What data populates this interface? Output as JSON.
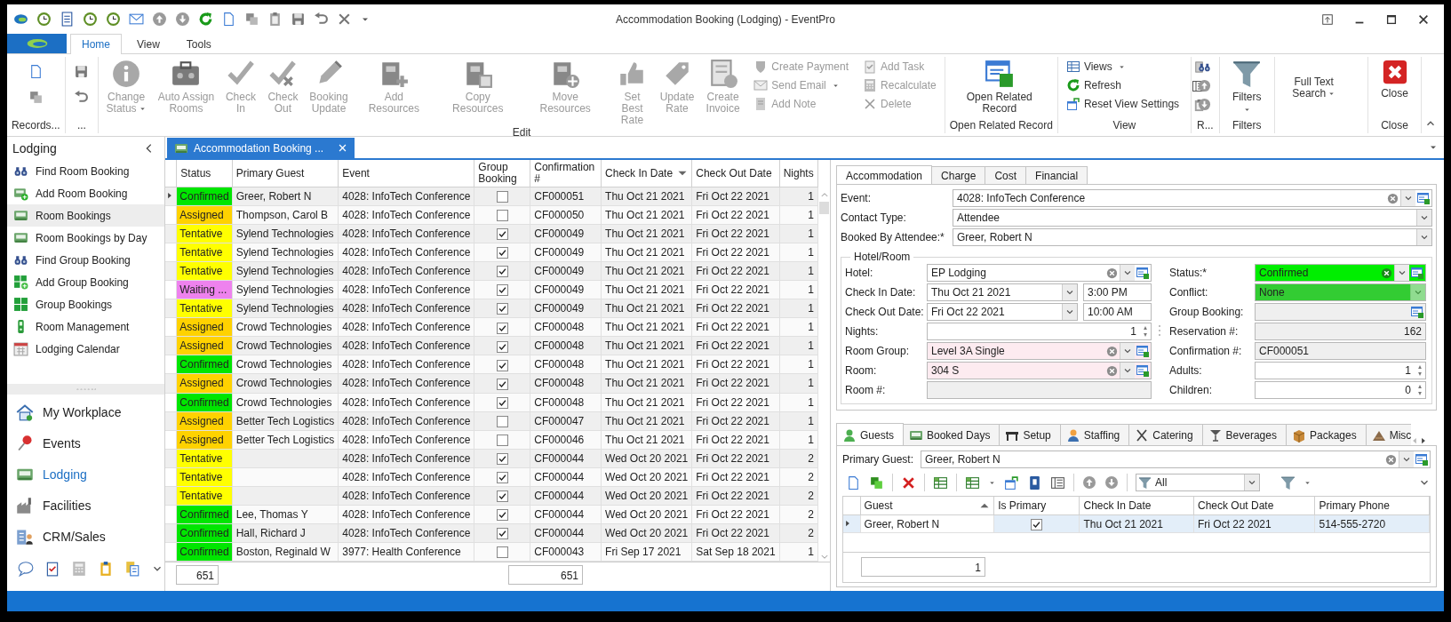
{
  "window": {
    "title": "Accommodation Booking (Lodging) - EventPro"
  },
  "ribbon": {
    "tabs": [
      {
        "label": "Home",
        "selected": true
      },
      {
        "label": "View",
        "selected": false
      },
      {
        "label": "Tools",
        "selected": false
      }
    ],
    "records_group": {
      "label": "Records..."
    },
    "save_group": {
      "label": "..."
    },
    "edit_group": {
      "label": "Edit",
      "large": [
        {
          "label": "Change Status",
          "dropdown": true,
          "disabled": true
        },
        {
          "label": "Auto Assign Rooms",
          "dropdown": false,
          "disabled": true
        },
        {
          "label": "Check In",
          "dropdown": false,
          "disabled": true
        },
        {
          "label": "Check Out",
          "dropdown": false,
          "disabled": true
        },
        {
          "label": "Booking Update",
          "dropdown": false,
          "disabled": true
        },
        {
          "label": "Add Resources",
          "dropdown": false,
          "disabled": true
        },
        {
          "label": "Copy Resources",
          "dropdown": false,
          "disabled": true
        },
        {
          "label": "Move Resources",
          "dropdown": false,
          "disabled": true
        },
        {
          "label": "Set Best Rate",
          "dropdown": false,
          "disabled": true
        },
        {
          "label": "Update Rate",
          "dropdown": false,
          "disabled": true
        },
        {
          "label": "Create Invoice",
          "dropdown": false,
          "disabled": true
        }
      ],
      "small": [
        {
          "label": "Create Payment",
          "dropdown": false,
          "disabled": true
        },
        {
          "label": "Send Email",
          "dropdown": true,
          "disabled": true
        },
        {
          "label": "Add Note",
          "dropdown": false,
          "disabled": true
        },
        {
          "label": "Add Task",
          "dropdown": false,
          "disabled": true
        },
        {
          "label": "Recalculate",
          "dropdown": false,
          "disabled": true
        },
        {
          "label": "Delete",
          "dropdown": false,
          "disabled": true
        }
      ]
    },
    "open_group": {
      "label": "Open Related Record",
      "button": "Open Related Record"
    },
    "view_group": {
      "label": "View",
      "buttons": [
        {
          "label": "Views",
          "dropdown": true
        },
        {
          "label": "Refresh",
          "dropdown": false
        },
        {
          "label": "Reset View Settings",
          "dropdown": false
        }
      ]
    },
    "r_group": {
      "label": "R..."
    },
    "filters_group": {
      "label": "Filters",
      "button": "Filters"
    },
    "search_button": "Full Text Search",
    "close_group": {
      "label": "Close",
      "button": "Close"
    }
  },
  "sidebar": {
    "title": "Lodging",
    "items": [
      {
        "label": "Find Room Booking",
        "selected": false
      },
      {
        "label": "Add Room Booking",
        "selected": false
      },
      {
        "label": "Room Bookings",
        "selected": true
      },
      {
        "label": "Room Bookings by Day",
        "selected": false
      },
      {
        "label": "Find Group Booking",
        "selected": false
      },
      {
        "label": "Add Group Booking",
        "selected": false
      },
      {
        "label": "Group Bookings",
        "selected": false
      },
      {
        "label": "Room Management",
        "selected": false
      },
      {
        "label": "Lodging Calendar",
        "selected": false
      }
    ],
    "nav": [
      {
        "label": "My Workplace",
        "selected": false
      },
      {
        "label": "Events",
        "selected": false
      },
      {
        "label": "Lodging",
        "selected": true
      },
      {
        "label": "Facilities",
        "selected": false
      },
      {
        "label": "CRM/Sales",
        "selected": false
      }
    ]
  },
  "document_tab": {
    "label": "Accommodation Booking ...",
    "selected": true
  },
  "grid": {
    "columns": [
      "Status",
      "Primary Guest",
      "Event",
      "Group Booking",
      "Confirmation #",
      "Check In Date",
      "Check Out Date",
      "Nights"
    ],
    "rows": [
      {
        "status": "Confirmed",
        "color": "#00e600",
        "guest": "Greer, Robert N",
        "event": "4028: InfoTech Conference",
        "group_booking": false,
        "confirmation": "CF000051",
        "check_in": "Thu Oct 21 2021",
        "check_out": "Fri Oct 22 2021",
        "nights": "1",
        "current": true
      },
      {
        "status": "Assigned",
        "color": "#ffd200",
        "guest": "Thompson, Carol B",
        "event": "4028: InfoTech Conference",
        "group_booking": false,
        "confirmation": "CF000050",
        "check_in": "Thu Oct 21 2021",
        "check_out": "Fri Oct 22 2021",
        "nights": "1",
        "current": false
      },
      {
        "status": "Tentative",
        "color": "#ffff00",
        "guest": "Sylend Technologies",
        "event": "4028: InfoTech Conference",
        "group_booking": true,
        "confirmation": "CF000049",
        "check_in": "Thu Oct 21 2021",
        "check_out": "Fri Oct 22 2021",
        "nights": "1",
        "current": false
      },
      {
        "status": "Tentative",
        "color": "#ffff00",
        "guest": "Sylend Technologies",
        "event": "4028: InfoTech Conference",
        "group_booking": true,
        "confirmation": "CF000049",
        "check_in": "Thu Oct 21 2021",
        "check_out": "Fri Oct 22 2021",
        "nights": "1",
        "current": false
      },
      {
        "status": "Tentative",
        "color": "#ffff00",
        "guest": "Sylend Technologies",
        "event": "4028: InfoTech Conference",
        "group_booking": true,
        "confirmation": "CF000049",
        "check_in": "Thu Oct 21 2021",
        "check_out": "Fri Oct 22 2021",
        "nights": "1",
        "current": false
      },
      {
        "status": "Waiting ...",
        "color": "#ee82ee",
        "guest": "Sylend Technologies",
        "event": "4028: InfoTech Conference",
        "group_booking": true,
        "confirmation": "CF000049",
        "check_in": "Thu Oct 21 2021",
        "check_out": "Fri Oct 22 2021",
        "nights": "1",
        "current": false
      },
      {
        "status": "Tentative",
        "color": "#ffff00",
        "guest": "Sylend Technologies",
        "event": "4028: InfoTech Conference",
        "group_booking": true,
        "confirmation": "CF000049",
        "check_in": "Thu Oct 21 2021",
        "check_out": "Fri Oct 22 2021",
        "nights": "1",
        "current": false
      },
      {
        "status": "Assigned",
        "color": "#ffd200",
        "guest": "Crowd Technologies",
        "event": "4028: InfoTech Conference",
        "group_booking": true,
        "confirmation": "CF000048",
        "check_in": "Thu Oct 21 2021",
        "check_out": "Fri Oct 22 2021",
        "nights": "1",
        "current": false
      },
      {
        "status": "Assigned",
        "color": "#ffd200",
        "guest": "Crowd Technologies",
        "event": "4028: InfoTech Conference",
        "group_booking": true,
        "confirmation": "CF000048",
        "check_in": "Thu Oct 21 2021",
        "check_out": "Fri Oct 22 2021",
        "nights": "1",
        "current": false
      },
      {
        "status": "Confirmed",
        "color": "#00e600",
        "guest": "Crowd Technologies",
        "event": "4028: InfoTech Conference",
        "group_booking": true,
        "confirmation": "CF000048",
        "check_in": "Thu Oct 21 2021",
        "check_out": "Fri Oct 22 2021",
        "nights": "1",
        "current": false
      },
      {
        "status": "Assigned",
        "color": "#ffd200",
        "guest": "Crowd Technologies",
        "event": "4028: InfoTech Conference",
        "group_booking": true,
        "confirmation": "CF000048",
        "check_in": "Thu Oct 21 2021",
        "check_out": "Fri Oct 22 2021",
        "nights": "1",
        "current": false
      },
      {
        "status": "Confirmed",
        "color": "#00e600",
        "guest": "Crowd Technologies",
        "event": "4028: InfoTech Conference",
        "group_booking": true,
        "confirmation": "CF000048",
        "check_in": "Thu Oct 21 2021",
        "check_out": "Fri Oct 22 2021",
        "nights": "1",
        "current": false
      },
      {
        "status": "Assigned",
        "color": "#ffd200",
        "guest": "Better Tech Logistics",
        "event": "4028: InfoTech Conference",
        "group_booking": false,
        "confirmation": "CF000047",
        "check_in": "Thu Oct 21 2021",
        "check_out": "Fri Oct 22 2021",
        "nights": "1",
        "current": false
      },
      {
        "status": "Assigned",
        "color": "#ffd200",
        "guest": "Better Tech Logistics",
        "event": "4028: InfoTech Conference",
        "group_booking": false,
        "confirmation": "CF000046",
        "check_in": "Thu Oct 21 2021",
        "check_out": "Fri Oct 22 2021",
        "nights": "1",
        "current": false
      },
      {
        "status": "Tentative",
        "color": "#ffff00",
        "event": "4028: InfoTech Conference",
        "group_booking": true,
        "confirmation": "CF000044",
        "check_in": "Wed Oct 20 2021",
        "check_out": "Fri Oct 22 2021",
        "nights": "2",
        "current": false
      },
      {
        "status": "Tentative",
        "color": "#ffff00",
        "event": "4028: InfoTech Conference",
        "group_booking": true,
        "confirmation": "CF000044",
        "check_in": "Wed Oct 20 2021",
        "check_out": "Fri Oct 22 2021",
        "nights": "2",
        "current": false
      },
      {
        "status": "Tentative",
        "color": "#ffff00",
        "event": "4028: InfoTech Conference",
        "group_booking": true,
        "confirmation": "CF000044",
        "check_in": "Wed Oct 20 2021",
        "check_out": "Fri Oct 22 2021",
        "nights": "2",
        "current": false
      },
      {
        "status": "Confirmed",
        "color": "#00e600",
        "guest": "Lee, Thomas Y",
        "event": "4028: InfoTech Conference",
        "group_booking": true,
        "confirmation": "CF000044",
        "check_in": "Wed Oct 20 2021",
        "check_out": "Fri Oct 22 2021",
        "nights": "2",
        "current": false
      },
      {
        "status": "Confirmed",
        "color": "#00e600",
        "guest": "Hall, Richard J",
        "event": "4028: InfoTech Conference",
        "group_booking": true,
        "confirmation": "CF000044",
        "check_in": "Wed Oct 20 2021",
        "check_out": "Fri Oct 22 2021",
        "nights": "2",
        "current": false
      },
      {
        "status": "Confirmed",
        "color": "#00e600",
        "guest": "Boston, Reginald W",
        "event": "3977: Health Conference",
        "group_booking": false,
        "confirmation": "CF000043",
        "check_in": "Fri Sep 17 2021",
        "check_out": "Sat Sep 18 2021",
        "nights": "1",
        "current": false
      }
    ],
    "summaries": {
      "status": "651",
      "confirmation": "651"
    }
  },
  "detail": {
    "tabs": [
      {
        "label": "Accommodation",
        "selected": true
      },
      {
        "label": "Charge",
        "selected": false
      },
      {
        "label": "Cost",
        "selected": false
      },
      {
        "label": "Financial",
        "selected": false
      }
    ],
    "fields": [
      {
        "label": "Event:",
        "value": "4028: InfoTech Conference",
        "kind": "combo",
        "disabled": false
      },
      {
        "label": "Contact Type:",
        "value": "Attendee",
        "kind": "dropdown",
        "disabled": false
      },
      {
        "label": "Booked By Attendee:*",
        "value": "Greer, Robert N",
        "kind": "dropdown",
        "disabled": false
      }
    ],
    "hotel_room": {
      "title": "Hotel/Room",
      "left": [
        {
          "label": "Hotel:",
          "value": "EP Lodging",
          "kind": "combo",
          "disabled": false
        },
        {
          "label": "Check In Date:",
          "value": "Thu Oct 21 2021",
          "time": "3:00 PM",
          "kind": "date",
          "disabled": false
        },
        {
          "label": "Check Out Date:",
          "value": "Fri Oct 22 2021",
          "time": "10:00 AM",
          "kind": "date",
          "disabled": false
        },
        {
          "label": "Nights:",
          "value": "1",
          "kind": "spin",
          "disabled": false
        },
        {
          "label": "Room Group:",
          "value": "Level 3A Single",
          "kind": "combo",
          "disabled": false,
          "color": "#fdebf0"
        },
        {
          "label": "Room:",
          "value": "304 S",
          "kind": "combo",
          "disabled": false,
          "color": "#fdebf0"
        },
        {
          "label": "Room #:",
          "kind": "text",
          "disabled": true
        }
      ],
      "right": [
        {
          "label": "Status:*",
          "value": "Confirmed",
          "kind": "combo",
          "disabled": false,
          "color": "#00ee00"
        },
        {
          "label": "Conflict:",
          "value": "None",
          "kind": "dropdown",
          "disabled": true,
          "color": "#33cc33"
        },
        {
          "label": "Group Booking:",
          "kind": "lookup",
          "disabled": true
        },
        {
          "label": "Reservation #:",
          "value": "162",
          "kind": "number",
          "disabled": true
        },
        {
          "label": "Confirmation #:",
          "value": "CF000051",
          "kind": "text",
          "disabled": true
        },
        {
          "label": "Adults:",
          "value": "1",
          "kind": "spin",
          "disabled": false
        },
        {
          "label": "Children:",
          "value": "0",
          "kind": "spin",
          "disabled": false
        }
      ]
    }
  },
  "guests_tabs": [
    {
      "label": "Guests",
      "selected": true
    },
    {
      "label": "Booked Days",
      "selected": false
    },
    {
      "label": "Setup",
      "selected": false
    },
    {
      "label": "Staffing",
      "selected": false
    },
    {
      "label": "Catering",
      "selected": false
    },
    {
      "label": "Beverages",
      "selected": false
    },
    {
      "label": "Packages",
      "selected": false
    },
    {
      "label": "Misc",
      "selected": false
    }
  ],
  "primary_guest": {
    "label": "Primary Guest:",
    "value": "Greer, Robert N"
  },
  "guest_filter": {
    "value": "All"
  },
  "guests_grid": {
    "columns": [
      {
        "label": "Guest",
        "sorted": true
      },
      {
        "label": "Is Primary",
        "sorted": false
      },
      {
        "label": "Check In Date",
        "sorted": false
      },
      {
        "label": "Check Out Date",
        "sorted": false
      },
      {
        "label": "Primary Phone",
        "sorted": false
      }
    ],
    "rows": [
      {
        "guest": "Greer, Robert N",
        "is_primary": true,
        "check_in": "Thu Oct 21 2021",
        "check_out": "Fri Oct 22 2021",
        "phone": "514-555-2720",
        "current": true
      }
    ],
    "summary": "1"
  }
}
